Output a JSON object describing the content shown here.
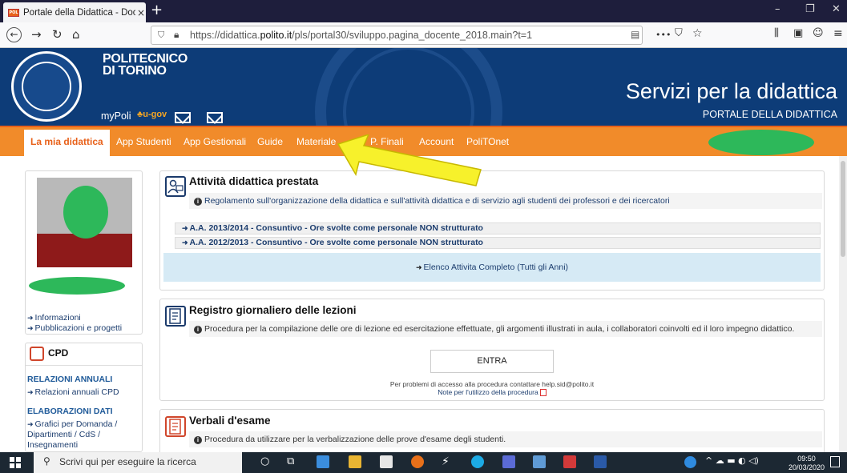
{
  "browser": {
    "tab_title": "Portale della Didattica - Docent",
    "tab_close": "×",
    "new_tab": "+",
    "url_prefix": "https://didattica.",
    "url_domain": "polito.it",
    "url_suffix": "/pls/portal30/sviluppo.pagina_docente_2018.main?t=1",
    "menu_dots": "•••",
    "window_minimize": "–",
    "window_restore": "❐",
    "window_close": "✕"
  },
  "header": {
    "logo_line1": "POLITECNICO",
    "logo_line2": "DI TORINO",
    "mypoli": "myPoli",
    "ugov": "u-gov",
    "title": "Servizi per la didattica",
    "subtitle": "PORTALE DELLA DIDATTICA"
  },
  "menu": {
    "items": [
      {
        "label": "La mia didattica",
        "active": true
      },
      {
        "label": "App Studenti"
      },
      {
        "label": "App Gestionali"
      },
      {
        "label": "Guide"
      },
      {
        "label": "Materiale"
      },
      {
        "label": "P. Finali"
      },
      {
        "label": "Account"
      },
      {
        "label": "PoliTOnet"
      }
    ]
  },
  "sidebar": {
    "links": [
      "Informazioni",
      "Pubblicazioni e progetti"
    ],
    "cpd_title": "CPD",
    "relazioni_head": "RELAZIONI ANNUALI",
    "relazioni_link": "Relazioni annuali CPD",
    "elaborazioni_head": "ELABORAZIONI DATI",
    "elaborazioni_link1": "Grafici per Domanda /",
    "elaborazioni_link2": "Dipartimenti / CdS /",
    "elaborazioni_link3": "Insegnamenti"
  },
  "panels": {
    "attivita": {
      "title": "Attività didattica prestata",
      "info": "Regolamento sull'organizzazione della didattica e sull'attività didattica e di servizio agli studenti dei professori e dei ricercatori",
      "rows": [
        "A.A. 2013/2014 - Consuntivo - Ore svolte come personale NON strutturato",
        "A.A. 2012/2013 - Consuntivo - Ore svolte come personale NON strutturato"
      ],
      "elenco": "Elenco Attivita Completo (Tutti gli Anni)"
    },
    "registro": {
      "title": "Registro giornaliero delle lezioni",
      "info": "Procedura per la compilazione delle ore di lezione ed esercitazione effettuate, gli argomenti illustrati in aula, i collaboratori coinvolti ed il loro impegno didattico.",
      "button": "ENTRA",
      "help": "Per problemi di accesso alla procedura contattare help.sid@polito.it",
      "note": "Note per l'utilizzo della procedura"
    },
    "verbali": {
      "title": "Verbali d'esame",
      "info": "Procedura da utilizzare per la verbalizzazione delle prove d'esame degli studenti."
    }
  },
  "taskbar": {
    "search_placeholder": "Scrivi qui per eseguire la ricerca",
    "time": "09:50",
    "date": "20/03/2020"
  },
  "colors": {
    "header_blue": "#0d3c78",
    "menu_orange": "#f18b2a",
    "highlight_yellow": "#f7f12b",
    "blur_green": "#2db85a"
  }
}
